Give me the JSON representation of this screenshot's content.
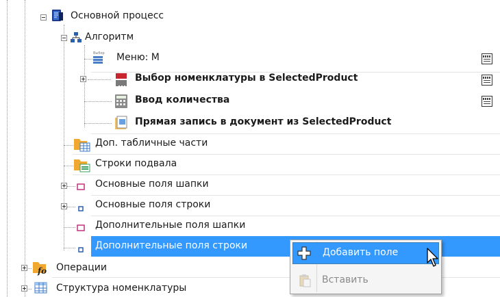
{
  "tree": {
    "main_process": "Основной процесс",
    "algorithm": "Алгоритм",
    "menu": "Меню: М",
    "select_nomenclature": "Выбор номенклатуры в SelectedProduct",
    "enter_quantity": "Ввод количества",
    "direct_write": "Прямая запись в документ из SelectedProduct",
    "extra_table_parts": "Доп. табличные части",
    "footer_rows": "Строки подвала",
    "header_main_fields": "Основные поля шапки",
    "row_main_fields": "Основные поля строки",
    "header_extra_fields": "Дополнительные поля шапки",
    "row_extra_fields": "Дополнительные поля строки",
    "operations": "Операции",
    "nomenclature_structure": "Структура номенклатуры"
  },
  "context_menu": {
    "add_field": "Добавить поле",
    "paste": "Вставить"
  },
  "colors": {
    "selection": "#3399ff",
    "menu_background": "#f5f5f5"
  }
}
